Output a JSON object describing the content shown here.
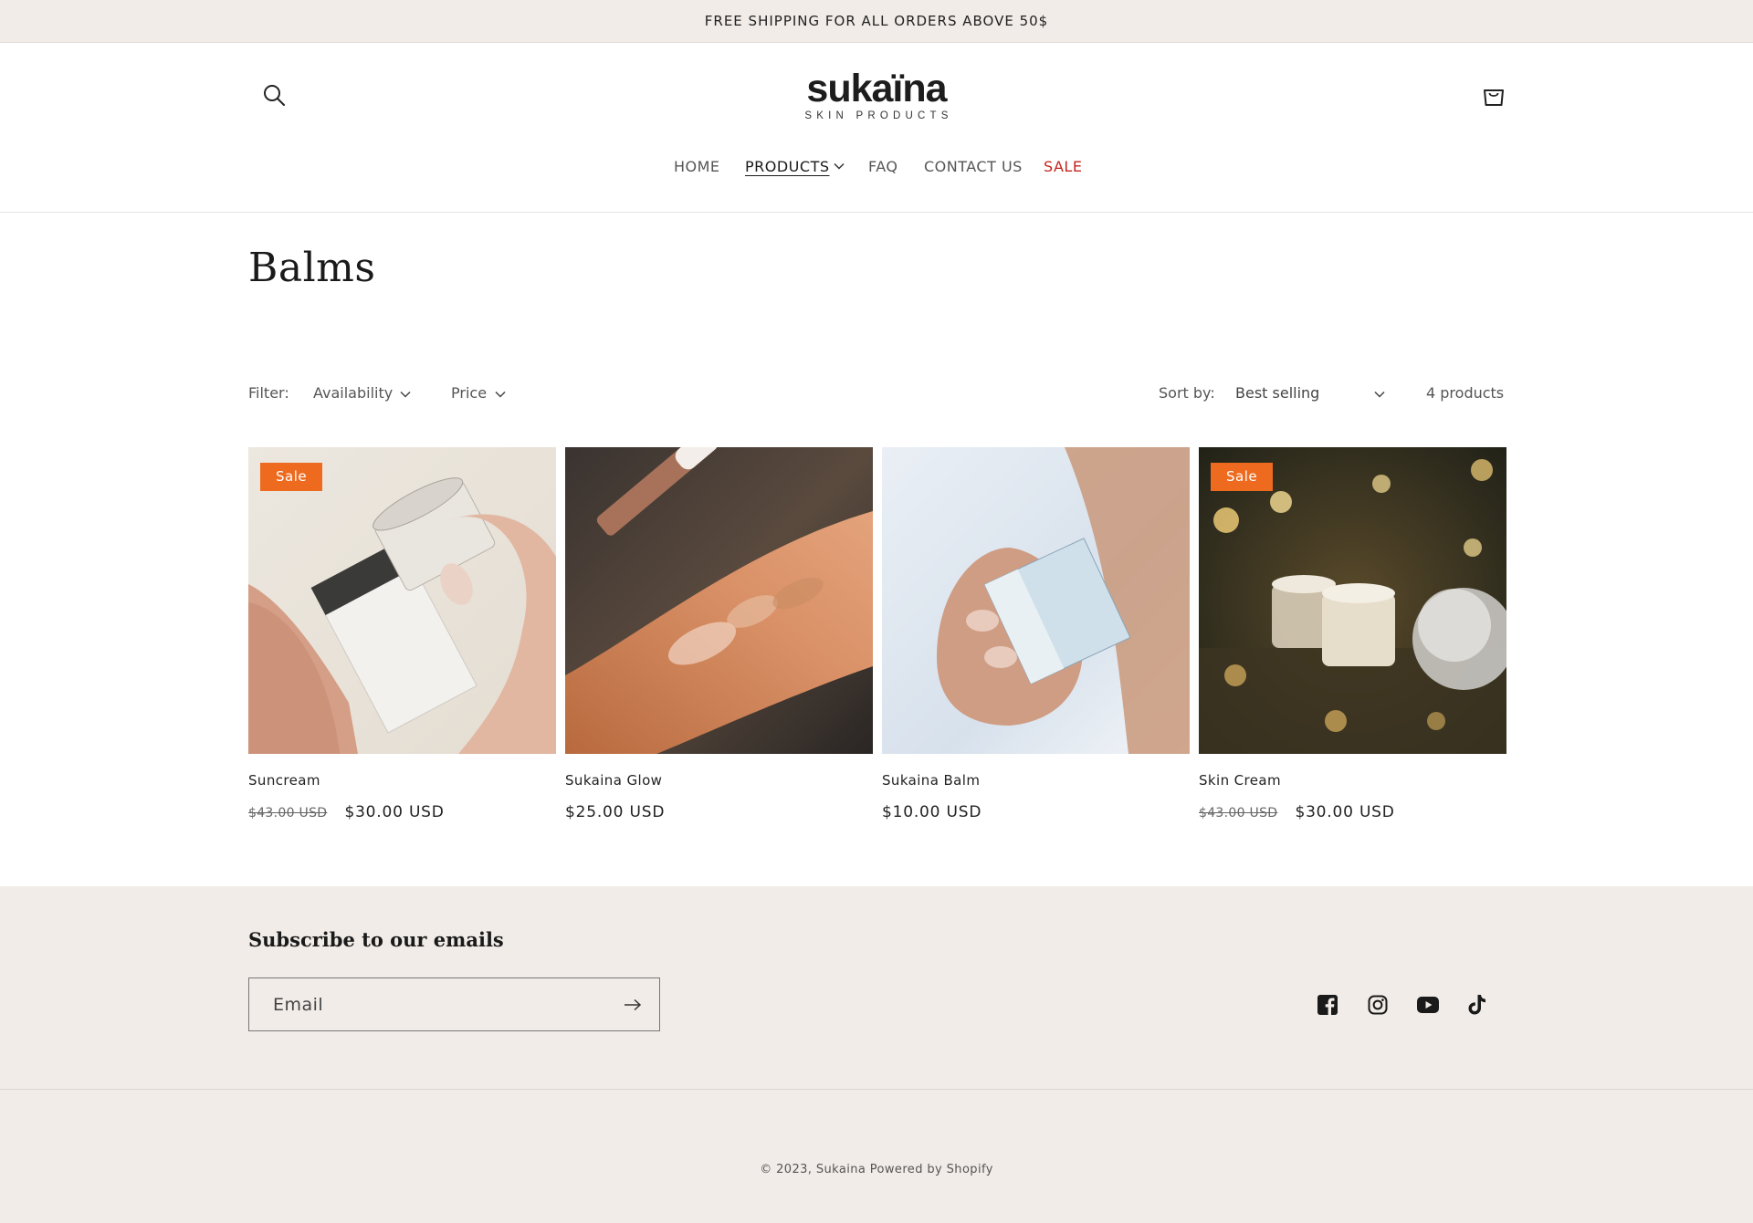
{
  "announcement": {
    "text": "FREE SHIPPING FOR ALL ORDERS ABOVE 50$"
  },
  "header": {
    "logo_main": "sukaïna",
    "logo_sub": "SKIN PRODUCTS",
    "nav": [
      {
        "label": "HOME"
      },
      {
        "label": "PRODUCTS",
        "active": true
      },
      {
        "label": "FAQ"
      },
      {
        "label": "CONTACT US"
      },
      {
        "label": "SALE",
        "color": "#c4251c"
      }
    ]
  },
  "collection": {
    "title": "Balms",
    "filter_label": "Filter:",
    "filters": [
      "Availability",
      "Price"
    ],
    "sort_label": "Sort by:",
    "sort_value": "Best selling",
    "count": "4 products"
  },
  "products": [
    {
      "name": "Suncream",
      "badge": "Sale",
      "old_price": "$43.00 USD",
      "price": "$30.00 USD"
    },
    {
      "name": "Sukaina Glow",
      "badge": "",
      "old_price": "",
      "price": "$25.00 USD"
    },
    {
      "name": "Sukaina Balm",
      "badge": "",
      "old_price": "",
      "price": "$10.00 USD"
    },
    {
      "name": "Skin Cream",
      "badge": "Sale",
      "old_price": "$43.00 USD",
      "price": "$30.00 USD"
    }
  ],
  "footer": {
    "subscribe_title": "Subscribe to our emails",
    "email_placeholder": "Email",
    "social": [
      "facebook-icon",
      "instagram-icon",
      "youtube-icon",
      "tiktok-icon"
    ],
    "copyright": "© 2023, Sukaina Powered by Shopify"
  },
  "colors": {
    "accent_sale": "#ed6a1e",
    "sale_nav": "#c4251c",
    "footer_bg": "#f1ece8"
  }
}
